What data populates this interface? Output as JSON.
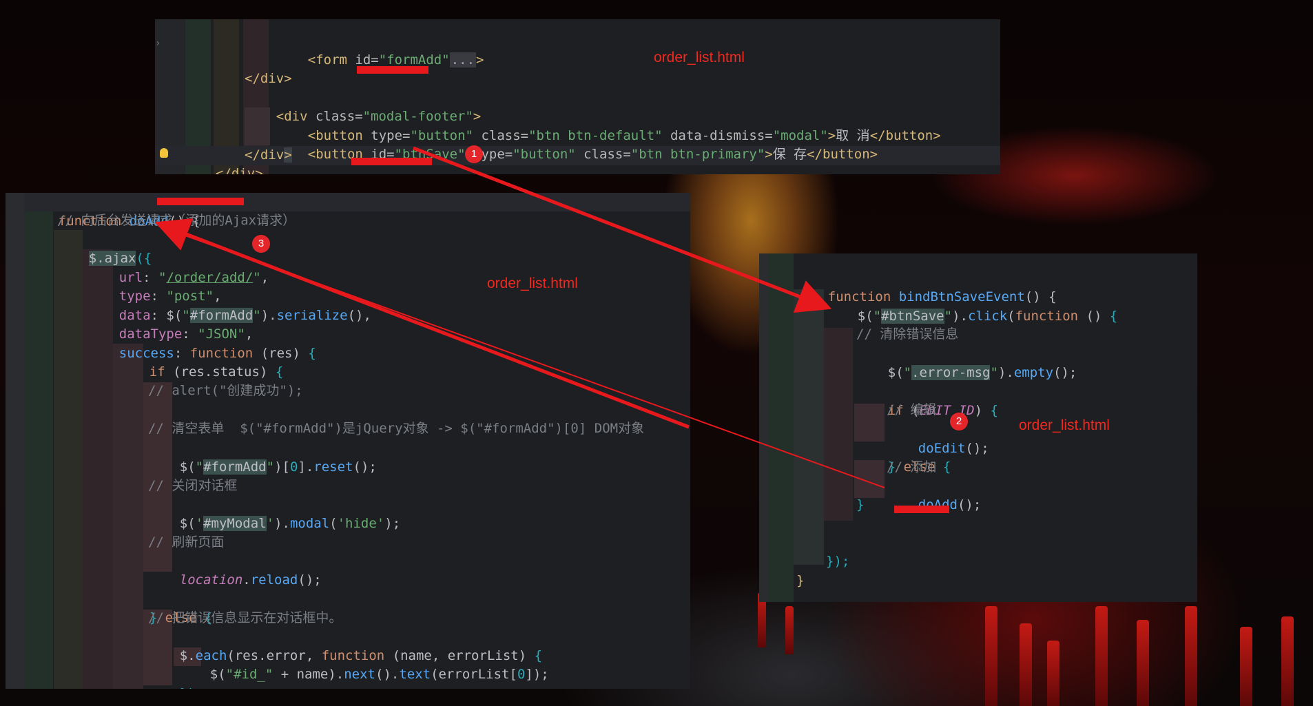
{
  "background": {
    "description_colors": {
      "dark": "#050303",
      "glow": "#a86f1d",
      "red": "#c41a14"
    }
  },
  "colors": {
    "annotation_red": "#e8191d",
    "editor_bg": "#1e1f22"
  },
  "top_panel": {
    "lines": [
      {
        "id": "t1",
        "text": "<form id=\"formAdd\"...>"
      },
      {
        "id": "t2",
        "text": "</div>"
      },
      {
        "id": "t3",
        "text": "<div class=\"modal-footer\">"
      },
      {
        "id": "t4",
        "text": "<button type=\"button\" class=\"btn btn-default\" data-dismiss=\"modal\">取 消</button>"
      },
      {
        "id": "t5",
        "text": "<button id=\"btnSave\" type=\"button\" class=\"btn btn-primary\">保 存</button>"
      },
      {
        "id": "t6",
        "text": "</div>"
      },
      {
        "id": "t7",
        "text": "</div>"
      }
    ],
    "file_label": "order_list.html"
  },
  "left_panel": {
    "file_label": "order_list.html",
    "tokens": {
      "function": "function",
      "doAdd": "doAdd",
      "open_paren_brace": "() {",
      "comment_send": "// 向后台发送请求（添加的Ajax请求）",
      "ajax": "$.ajax",
      "url_key": "url",
      "url_val": "/order/add/",
      "type_key": "type",
      "type_val": "\"post\"",
      "data_key": "data",
      "formAdd_sel": "#formAdd",
      "serialize": "serialize",
      "datatype_key": "dataType",
      "datatype_val": "\"JSON\"",
      "success_key": "success",
      "res": "res",
      "if": "if",
      "res_status": "res.status",
      "comment_alert": "// alert(\"创建成功\");",
      "comment_clear": "// 清空表单  $(\"#formAdd\")是jQuery对象 -> $(\"#formAdd\")[0] DOM对象",
      "reset": "reset",
      "comment_close": "// 关闭对话框",
      "myModal_sel": "#myModal",
      "modal": "modal",
      "hide": "'hide'",
      "comment_refresh": "// 刷新页面",
      "location": "location",
      "reload": "reload",
      "else": "else",
      "comment_error": "// 把错误信息显示在对话框中。",
      "each": "each",
      "res_error": "res.error",
      "name_errorList": "(name, errorList)",
      "id_prefix": "\"#id_\"",
      "next": "next",
      "text": "text",
      "errorList0": "errorList",
      "zero": "0",
      "close_paren": "})"
    }
  },
  "right_panel": {
    "file_label": "order_list.html",
    "tokens": {
      "function": "function",
      "bindBtnSaveEvent": "bindBtnSaveEvent",
      "btnSave_sel": "#btnSave",
      "click": "click",
      "comment_clear_err": "// 清除错误信息",
      "error_msg": ".error-msg",
      "empty": "empty",
      "if": "if",
      "edit_id": "EDIT_ID",
      "comment_edit": "// 编辑",
      "doEdit": "doEdit",
      "else": "else",
      "comment_add": "// 添加",
      "doAdd": "doAdd",
      "close_all": "});",
      "close_fn": "}"
    }
  },
  "badges": [
    "1",
    "2",
    "3"
  ]
}
